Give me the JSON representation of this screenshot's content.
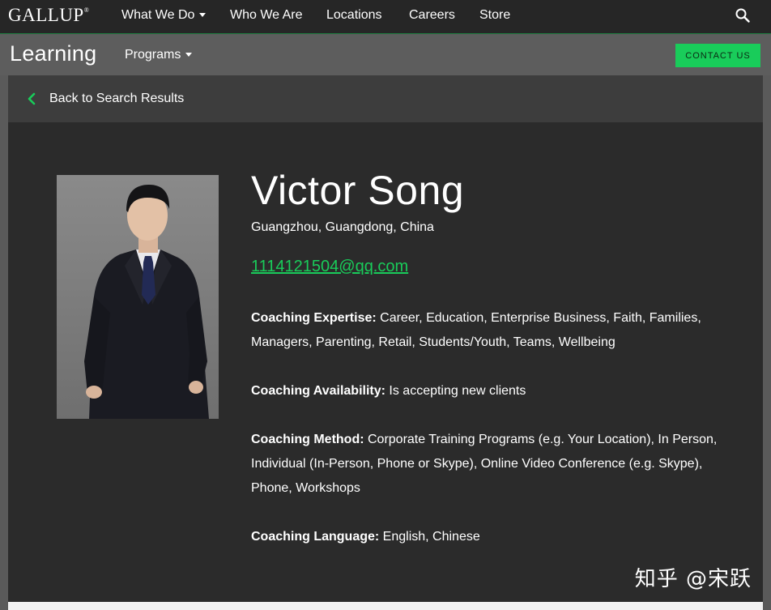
{
  "topnav": {
    "logo": "GALLUP",
    "items": [
      {
        "label": "What We Do",
        "dropdown": true
      },
      {
        "label": "Who We Are",
        "dropdown": false
      },
      {
        "label": "Locations",
        "dropdown": false
      },
      {
        "label": "Careers",
        "dropdown": false
      },
      {
        "label": "Store",
        "dropdown": false
      }
    ],
    "search_icon": "search-icon"
  },
  "subnav": {
    "title": "Learning",
    "programs_label": "Programs",
    "contact_label": "CONTACT US"
  },
  "back": {
    "label": "Back to Search Results",
    "icon": "chevron-left-icon"
  },
  "profile": {
    "name": "Victor Song",
    "location": "Guangzhou, Guangdong, China",
    "email": "1114121504@qq.com",
    "expertise_label": "Coaching Expertise:",
    "expertise_value": " Career, Education, Enterprise Business, Faith, Families, Managers, Parenting, Retail, Students/Youth, Teams, Wellbeing",
    "availability_label": "Coaching Availability:",
    "availability_value": " Is accepting new clients",
    "method_label": "Coaching Method:",
    "method_value": " Corporate Training Programs (e.g. Your Location), In Person, Individual (In-Person, Phone or Skype), Online Video Conference (e.g. Skype), Phone, Workshops",
    "language_label": "Coaching Language:",
    "language_value": " English, Chinese"
  },
  "watermark": "知乎 @宋跃",
  "colors": {
    "accent": "#19cc5a",
    "topnav_bg": "#262626",
    "panel_bg": "#2b2b2b"
  }
}
